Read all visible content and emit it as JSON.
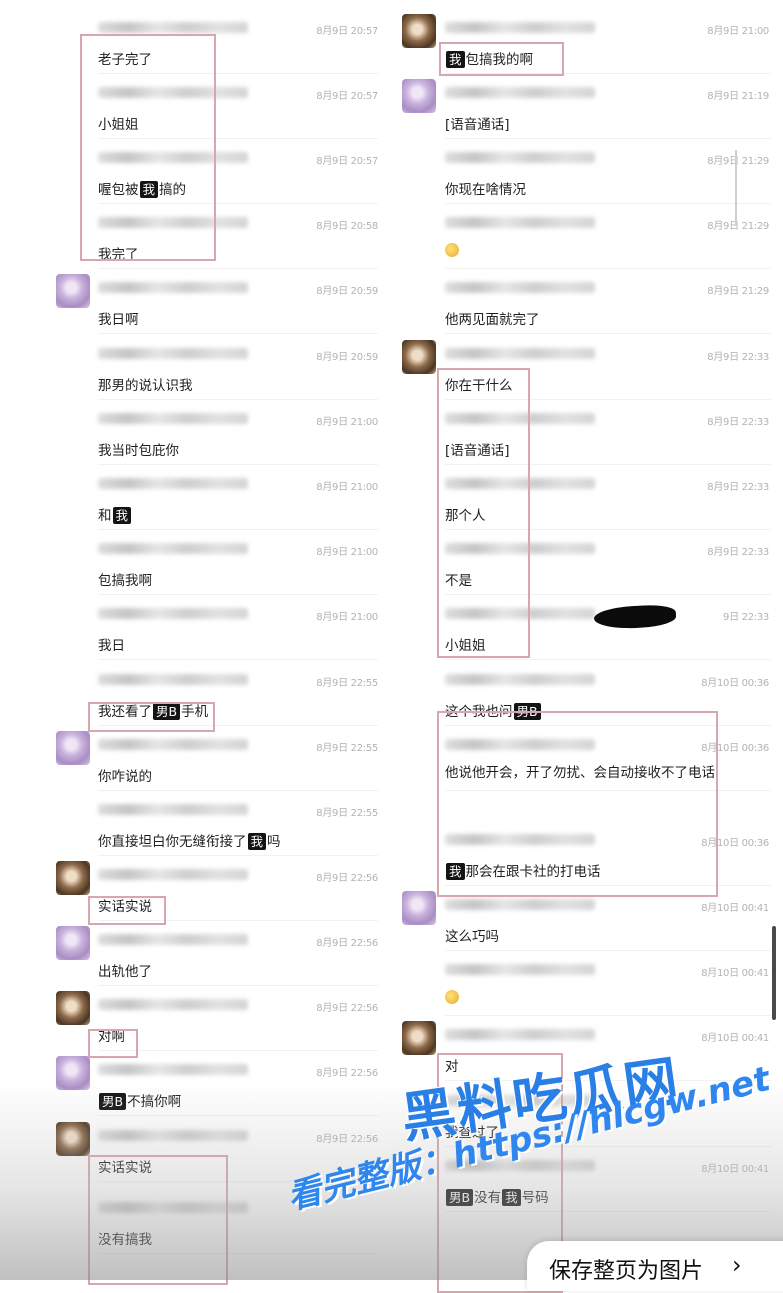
{
  "left": [
    {
      "time": "8月9日 20:57",
      "text": [
        "老子完了"
      ]
    },
    {
      "time": "8月9日 20:57",
      "text": [
        "小姐姐"
      ]
    },
    {
      "time": "8月9日 20:57",
      "text": [
        "喔包被",
        {
          "hl": "我"
        },
        "搞的"
      ]
    },
    {
      "time": "8月9日 20:58",
      "text": [
        "我完了"
      ]
    },
    {
      "avatar": "purple",
      "time": "8月9日 20:59",
      "text": [
        "我日啊"
      ]
    },
    {
      "time": "8月9日 20:59",
      "text": [
        "那男的说认识我"
      ]
    },
    {
      "time": "8月9日 21:00",
      "text": [
        "我当时包庇你"
      ]
    },
    {
      "time": "8月9日 21:00",
      "text": [
        "和",
        {
          "hl": "我"
        }
      ]
    },
    {
      "time": "8月9日 21:00",
      "text": [
        "包搞我啊"
      ]
    },
    {
      "time": "8月9日 21:00",
      "text": [
        "我日"
      ]
    },
    {
      "time": "8月9日 22:55",
      "text": [
        "我还看了",
        {
          "hl": "男B"
        },
        "手机"
      ]
    },
    {
      "avatar": "purple",
      "time": "8月9日 22:55",
      "text": [
        "你咋说的"
      ]
    },
    {
      "time": "8月9日 22:55",
      "text": [
        "你直接坦白你无缝衔接了",
        {
          "hl": "我"
        },
        "吗"
      ]
    },
    {
      "avatar": "brown",
      "time": "8月9日 22:56",
      "text": [
        "实话实说"
      ]
    },
    {
      "avatar": "purple",
      "time": "8月9日 22:56",
      "text": [
        "出轨他了"
      ]
    },
    {
      "avatar": "brown",
      "time": "8月9日 22:56",
      "text": [
        "对啊"
      ]
    },
    {
      "avatar": "purple",
      "time": "8月9日 22:56",
      "text": [
        {
          "hl": "男B"
        },
        "不搞你啊"
      ]
    },
    {
      "avatar": "brown",
      "time": "8月9日 22:56",
      "text": [
        "实话实说"
      ]
    },
    {
      "time": "",
      "text": [
        "没有搞我"
      ]
    }
  ],
  "right": [
    {
      "avatar": "brown",
      "time": "8月9日 21:00",
      "text": [
        {
          "hl": "我"
        },
        "包搞我的啊"
      ]
    },
    {
      "avatar": "purple",
      "time": "8月9日 21:19",
      "text": [
        "[语音通话]"
      ]
    },
    {
      "time": "8月9日 21:29",
      "text": [
        "你现在啥情况"
      ]
    },
    {
      "time": "8月9日 21:29",
      "text": [
        {
          "emoji": true
        }
      ]
    },
    {
      "time": "8月9日 21:29",
      "text": [
        "他两见面就完了"
      ]
    },
    {
      "avatar": "brown",
      "time": "8月9日 22:33",
      "text": [
        "你在干什么"
      ]
    },
    {
      "time": "8月9日 22:33",
      "text": [
        "[语音通话]"
      ]
    },
    {
      "time": "8月9日 22:33",
      "text": [
        "那个人"
      ]
    },
    {
      "time": "8月9日 22:33",
      "text": [
        "不是"
      ]
    },
    {
      "time": "9日 22:33",
      "text": [
        "小姐姐"
      ]
    },
    {
      "time": "8月10日 00:36",
      "text": [
        "这个我也问",
        {
          "hl": "男B"
        }
      ]
    },
    {
      "time": "8月10日 00:36",
      "wrap": true,
      "text": [
        "他说他开会，开了勿扰、会自动接收不了电话"
      ]
    },
    {
      "time": "8月10日 00:36",
      "text": [
        {
          "hl": "我"
        },
        "那会在跟卡社的打电话"
      ]
    },
    {
      "avatar": "purple",
      "time": "8月10日 00:41",
      "text": [
        "这么巧吗"
      ]
    },
    {
      "time": "8月10日 00:41",
      "text": [
        {
          "emoji": true
        }
      ]
    },
    {
      "avatar": "brown",
      "time": "8月10日 00:41",
      "text": [
        "对"
      ]
    },
    {
      "time": "",
      "text": [
        "我查过了"
      ]
    },
    {
      "time": "8月10日 00:41",
      "text": [
        {
          "hl": "男B"
        },
        "没有",
        {
          "hl": "我"
        },
        "号码"
      ]
    }
  ],
  "watermark": {
    "logo": "黑料吃瓜网",
    "prefix": "看完整版：",
    "url": "https://hlcgw.net"
  },
  "save_bar": {
    "label": "保存整页为图片",
    "arrow": "›"
  }
}
